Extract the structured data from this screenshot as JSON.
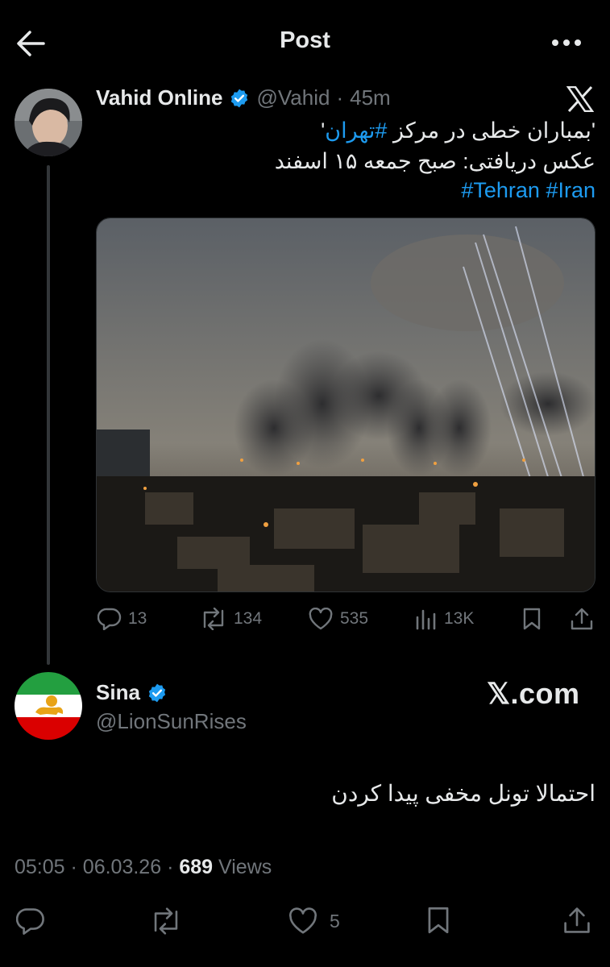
{
  "header": {
    "title": "Post"
  },
  "tweet": {
    "author_name": "Vahid Online",
    "handle": "@Vahid",
    "separator": "·",
    "time": "45m",
    "text_line1_prefix": "'بمباران خطی در مرکز ",
    "text_line1_hashtag": "#تهران",
    "text_line1_suffix": "'",
    "text_line2": "عکس دریافتی: صبح جمعه ۱۵ اسفند",
    "hashtags": [
      "#Tehran",
      "#Iran"
    ],
    "actions": {
      "replies": "13",
      "reposts": "134",
      "likes": "535",
      "views": "13K"
    }
  },
  "reply": {
    "author_name": "Sina",
    "handle": "@LionSunRises",
    "watermark": "𝕏.com",
    "text": "احتمالا تونل مخفی پیدا کردن",
    "meta": {
      "time": "05:05",
      "date": "06.03.26",
      "views_count": "689",
      "views_label": "Views",
      "dot": "·"
    },
    "actions": {
      "likes": "5"
    }
  },
  "colors": {
    "accent": "#1d9bf0",
    "muted": "#71767b",
    "text": "#e7e9ea",
    "background": "#000000"
  }
}
